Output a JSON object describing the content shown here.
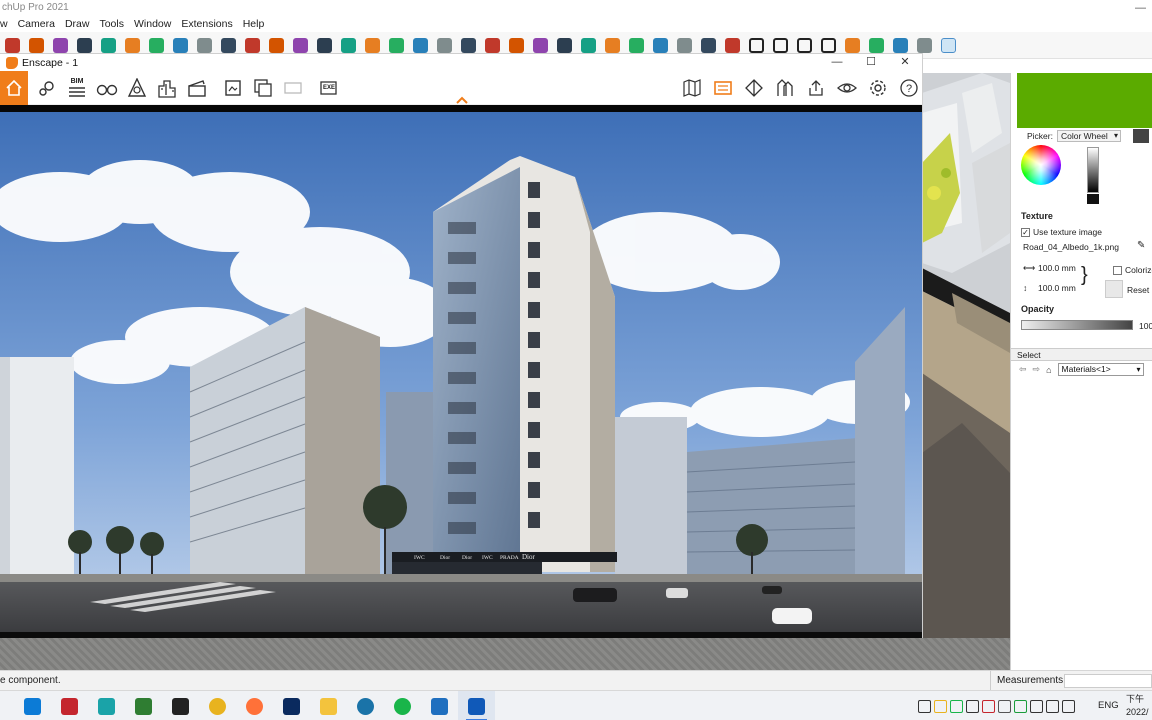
{
  "sketchup": {
    "title": "chUp Pro 2021",
    "menu": [
      "w",
      "Camera",
      "Draw",
      "Tools",
      "Window",
      "Extensions",
      "Help"
    ],
    "toolbar_icons": [
      "pencil-icon",
      "eraser-icon",
      "paint-bucket-icon",
      "push-pull-icon",
      "follow-me-icon",
      "move-icon",
      "rotate-icon",
      "scale-icon",
      "tape-measure-icon",
      "text-icon",
      "paint-icon",
      "orbit-icon",
      "hand-icon",
      "zoom-icon",
      "zoom-extents-icon",
      "section-icon",
      "layers-icon",
      "layers-2-icon",
      "layers-3-icon",
      "user-icon",
      "enscape-start-icon",
      "enscape-sync-icon",
      "enscape-capture-icon",
      "plus-icon",
      "tree-icon",
      "terrain-icon",
      "checker-icon",
      "cloud-icon",
      "gear-icon",
      "mail-icon",
      "info-icon",
      "dot-icon",
      "minus-icon",
      "square-icon",
      "eye-slash-icon",
      "profile-icon",
      "target-icon",
      "video-icon",
      "screenshot-icon",
      "help-icon"
    ],
    "status_message": "e component.",
    "measurements_label": "Measurements"
  },
  "enscape": {
    "title": "Enscape - 1",
    "window_controls": [
      "—",
      "☐",
      "✕"
    ],
    "toolbar_left": [
      "home-icon",
      "location-icon",
      "bim-icon",
      "binoculars-icon",
      "asset-library-icon",
      "buildings-icon",
      "clapboard-icon",
      "export-image-icon",
      "batch-render-icon",
      "panorama-icon",
      "exe-export-icon"
    ],
    "bim_label": "BIM",
    "exe_label": "EXE",
    "toolbar_right": [
      "map-icon",
      "safe-frame-icon",
      "vr-icon",
      "material-editor-icon",
      "upload-icon",
      "view-icon",
      "settings-icon",
      "help-icon"
    ]
  },
  "render_signage": [
    "IWC",
    "Dior",
    "Dior",
    "IWC",
    "PRADA",
    "Dior"
  ],
  "material_panel": {
    "swatch_color": "#5bab00",
    "picker_label": "Picker:",
    "picker_value": "Color Wheel",
    "texture_heading": "Texture",
    "use_texture_label": "Use texture image",
    "use_texture_checked": true,
    "texture_file": "Road_04_Albedo_1k.png",
    "width_value": "100.0 mm",
    "height_value": "100.0 mm",
    "colorize_label": "Colorize",
    "reset_label": "Reset C",
    "opacity_heading": "Opacity",
    "opacity_value": "100",
    "select_heading": "Select",
    "materials_combo": "Materials<1>"
  },
  "taskbar": {
    "apps": [
      {
        "name": "edge-icon",
        "color": "#0c7bd6"
      },
      {
        "name": "autocad-icon",
        "color": "#c4262e"
      },
      {
        "name": "sketchup-file-icon",
        "color": "#1aa3a8"
      },
      {
        "name": "xbox-icon",
        "color": "#2f7d32"
      },
      {
        "name": "typora-icon",
        "color": "#222222"
      },
      {
        "name": "chrome-icon",
        "color": "#e8b31f"
      },
      {
        "name": "firefox-icon",
        "color": "#ff7139"
      },
      {
        "name": "photoshop-icon",
        "color": "#0a2a5e"
      },
      {
        "name": "file-explorer-icon",
        "color": "#f3c33d"
      },
      {
        "name": "browser-icon",
        "color": "#1a73a8"
      },
      {
        "name": "line-icon",
        "color": "#19b54a"
      },
      {
        "name": "photos-icon",
        "color": "#1f6fbf"
      },
      {
        "name": "sketchup-icon",
        "color": "#1059b8"
      }
    ],
    "language": "ENG",
    "clock_time": "下午",
    "clock_date": "2022/"
  }
}
